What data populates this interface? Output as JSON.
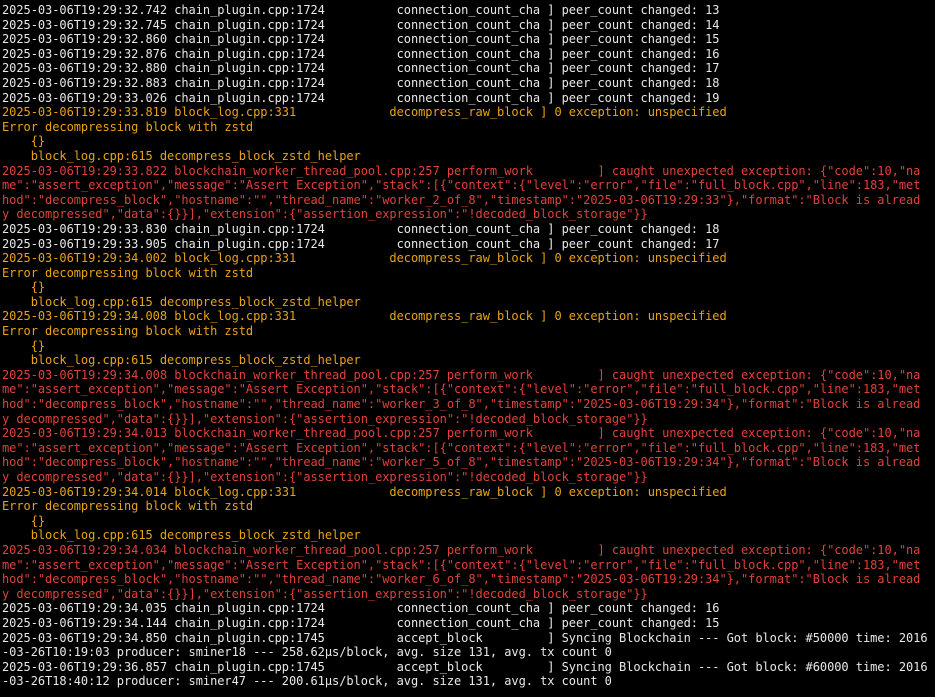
{
  "terminal": {
    "colors": {
      "background": "#000000",
      "info": "#e8e8e8",
      "warn": "#e8a317",
      "error": "#e0413b",
      "debug": "#e8e8e8"
    },
    "lines": [
      {
        "level": "info",
        "text": "2025-03-06T19:29:32.742 chain_plugin.cpp:1724          connection_count_cha ] peer_count changed: 13"
      },
      {
        "level": "info",
        "text": "2025-03-06T19:29:32.745 chain_plugin.cpp:1724          connection_count_cha ] peer_count changed: 14"
      },
      {
        "level": "info",
        "text": "2025-03-06T19:29:32.860 chain_plugin.cpp:1724          connection_count_cha ] peer_count changed: 15"
      },
      {
        "level": "info",
        "text": "2025-03-06T19:29:32.876 chain_plugin.cpp:1724          connection_count_cha ] peer_count changed: 16"
      },
      {
        "level": "info",
        "text": "2025-03-06T19:29:32.880 chain_plugin.cpp:1724          connection_count_cha ] peer_count changed: 17"
      },
      {
        "level": "info",
        "text": "2025-03-06T19:29:32.883 chain_plugin.cpp:1724          connection_count_cha ] peer_count changed: 18"
      },
      {
        "level": "info",
        "text": "2025-03-06T19:29:33.026 chain_plugin.cpp:1724          connection_count_cha ] peer_count changed: 19"
      },
      {
        "level": "warn",
        "text": "2025-03-06T19:29:33.819 block_log.cpp:331             decompress_raw_block ] 0 exception: unspecified"
      },
      {
        "level": "warn",
        "text": "Error decompressing block with zstd"
      },
      {
        "level": "warn",
        "text": "    {}"
      },
      {
        "level": "warn",
        "text": "    block_log.cpp:615 decompress_block_zstd_helper"
      },
      {
        "level": "error",
        "text": "2025-03-06T19:29:33.822 blockchain_worker_thread_pool.cpp:257 perform_work         ] caught unexpected exception: {\"code\":10,\"na"
      },
      {
        "level": "error",
        "text": "me\":\"assert_exception\",\"message\":\"Assert Exception\",\"stack\":[{\"context\":{\"level\":\"error\",\"file\":\"full_block.cpp\",\"line\":183,\"met"
      },
      {
        "level": "error",
        "text": "hod\":\"decompress_block\",\"hostname\":\"\",\"thread_name\":\"worker_2_of_8\",\"timestamp\":\"2025-03-06T19:29:33\"},\"format\":\"Block is alread"
      },
      {
        "level": "error",
        "text": "y decompressed\",\"data\":{}}],\"extension\":{\"assertion_expression\":\"!decoded_block_storage\"}}"
      },
      {
        "level": "info",
        "text": "2025-03-06T19:29:33.830 chain_plugin.cpp:1724          connection_count_cha ] peer_count changed: 18"
      },
      {
        "level": "info",
        "text": "2025-03-06T19:29:33.905 chain_plugin.cpp:1724          connection_count_cha ] peer_count changed: 17"
      },
      {
        "level": "warn",
        "text": "2025-03-06T19:29:34.002 block_log.cpp:331             decompress_raw_block ] 0 exception: unspecified"
      },
      {
        "level": "warn",
        "text": "Error decompressing block with zstd"
      },
      {
        "level": "warn",
        "text": "    {}"
      },
      {
        "level": "warn",
        "text": "    block_log.cpp:615 decompress_block_zstd_helper"
      },
      {
        "level": "warn",
        "text": "2025-03-06T19:29:34.008 block_log.cpp:331             decompress_raw_block ] 0 exception: unspecified"
      },
      {
        "level": "warn",
        "text": "Error decompressing block with zstd"
      },
      {
        "level": "warn",
        "text": "    {}"
      },
      {
        "level": "warn",
        "text": "    block_log.cpp:615 decompress_block_zstd_helper"
      },
      {
        "level": "error",
        "text": "2025-03-06T19:29:34.008 blockchain_worker_thread_pool.cpp:257 perform_work         ] caught unexpected exception: {\"code\":10,\"na"
      },
      {
        "level": "error",
        "text": "me\":\"assert_exception\",\"message\":\"Assert Exception\",\"stack\":[{\"context\":{\"level\":\"error\",\"file\":\"full_block.cpp\",\"line\":183,\"met"
      },
      {
        "level": "error",
        "text": "hod\":\"decompress_block\",\"hostname\":\"\",\"thread_name\":\"worker_3_of_8\",\"timestamp\":\"2025-03-06T19:29:34\"},\"format\":\"Block is alread"
      },
      {
        "level": "error",
        "text": "y decompressed\",\"data\":{}}],\"extension\":{\"assertion_expression\":\"!decoded_block_storage\"}}"
      },
      {
        "level": "error",
        "text": "2025-03-06T19:29:34.013 blockchain_worker_thread_pool.cpp:257 perform_work         ] caught unexpected exception: {\"code\":10,\"na"
      },
      {
        "level": "error",
        "text": "me\":\"assert_exception\",\"message\":\"Assert Exception\",\"stack\":[{\"context\":{\"level\":\"error\",\"file\":\"full_block.cpp\",\"line\":183,\"met"
      },
      {
        "level": "error",
        "text": "hod\":\"decompress_block\",\"hostname\":\"\",\"thread_name\":\"worker_5_of_8\",\"timestamp\":\"2025-03-06T19:29:34\"},\"format\":\"Block is alread"
      },
      {
        "level": "error",
        "text": "y decompressed\",\"data\":{}}],\"extension\":{\"assertion_expression\":\"!decoded_block_storage\"}}"
      },
      {
        "level": "warn",
        "text": "2025-03-06T19:29:34.014 block_log.cpp:331             decompress_raw_block ] 0 exception: unspecified"
      },
      {
        "level": "warn",
        "text": "Error decompressing block with zstd"
      },
      {
        "level": "warn",
        "text": "    {}"
      },
      {
        "level": "warn",
        "text": "    block_log.cpp:615 decompress_block_zstd_helper"
      },
      {
        "level": "error",
        "text": "2025-03-06T19:29:34.034 blockchain_worker_thread_pool.cpp:257 perform_work         ] caught unexpected exception: {\"code\":10,\"na"
      },
      {
        "level": "error",
        "text": "me\":\"assert_exception\",\"message\":\"Assert Exception\",\"stack\":[{\"context\":{\"level\":\"error\",\"file\":\"full_block.cpp\",\"line\":183,\"met"
      },
      {
        "level": "error",
        "text": "hod\":\"decompress_block\",\"hostname\":\"\",\"thread_name\":\"worker_6_of_8\",\"timestamp\":\"2025-03-06T19:29:34\"},\"format\":\"Block is alread"
      },
      {
        "level": "error",
        "text": "y decompressed\",\"data\":{}}],\"extension\":{\"assertion_expression\":\"!decoded_block_storage\"}}"
      },
      {
        "level": "info",
        "text": "2025-03-06T19:29:34.035 chain_plugin.cpp:1724          connection_count_cha ] peer_count changed: 16"
      },
      {
        "level": "info",
        "text": "2025-03-06T19:29:34.144 chain_plugin.cpp:1724          connection_count_cha ] peer_count changed: 15"
      },
      {
        "level": "debug",
        "text": "2025-03-06T19:29:34.850 chain_plugin.cpp:1745          accept_block         ] Syncing Blockchain --- Got block: #50000 time: 2016"
      },
      {
        "level": "debug",
        "text": "-03-26T10:19:03 producer: sminer18 --- 258.62µs/block, avg. size 131, avg. tx count 0"
      },
      {
        "level": "debug",
        "text": "2025-03-06T19:29:36.857 chain_plugin.cpp:1745          accept_block         ] Syncing Blockchain --- Got block: #60000 time: 2016"
      },
      {
        "level": "debug",
        "text": "-03-26T18:40:12 producer: sminer47 --- 200.61µs/block, avg. size 131, avg. tx count 0"
      }
    ]
  }
}
